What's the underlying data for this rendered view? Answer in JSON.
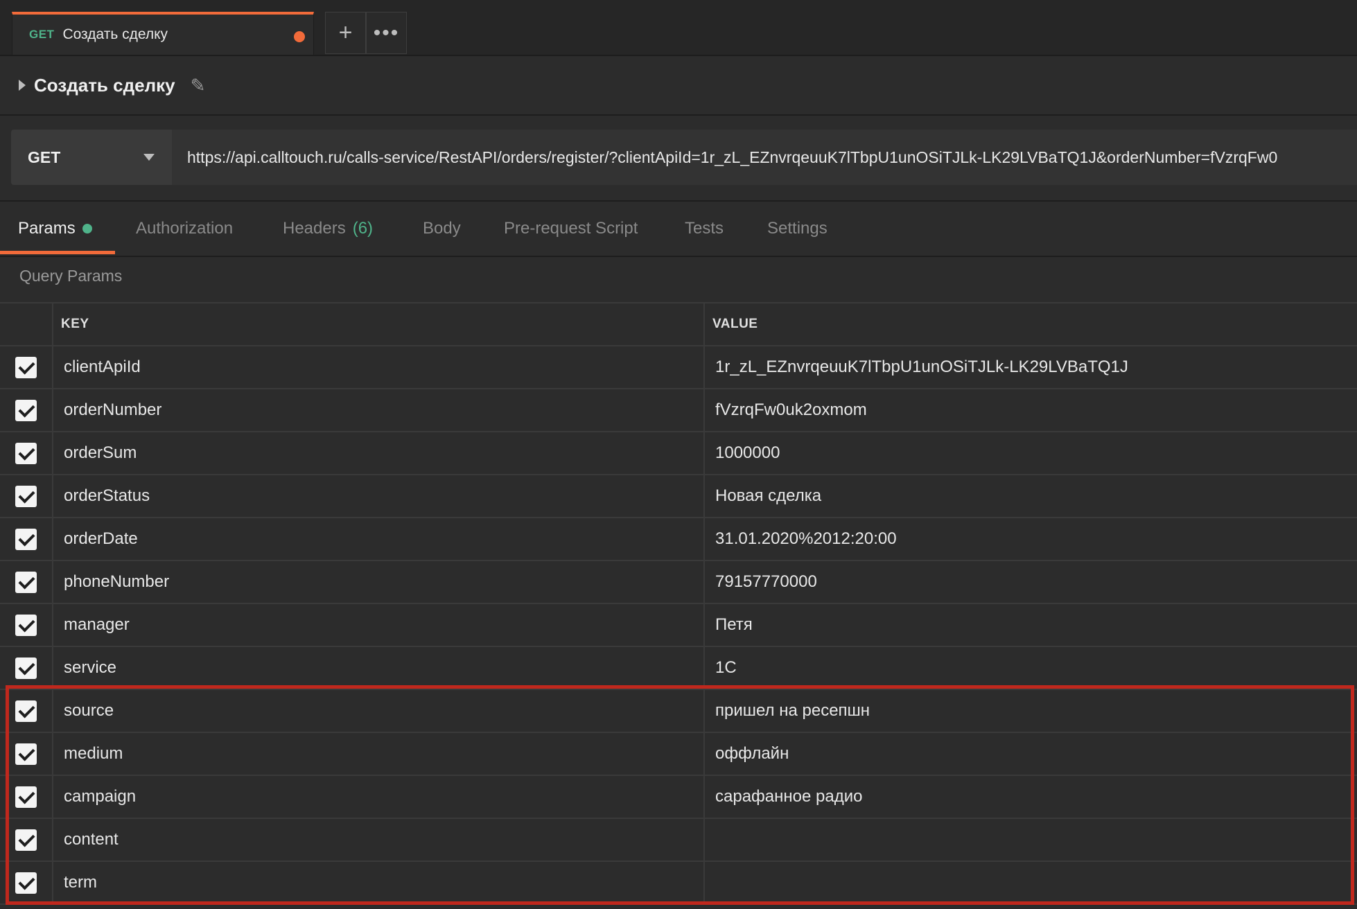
{
  "tab": {
    "method": "GET",
    "name": "Создать сделку",
    "unsaved": true
  },
  "tab_actions": {
    "new_tab": "+",
    "more": "•••"
  },
  "request": {
    "title": "Создать сделку"
  },
  "url_bar": {
    "method": "GET",
    "url": "https://api.calltouch.ru/calls-service/RestAPI/orders/register/?clientApiId=1r_zL_EZnvrqeuuK7lTbpU1unOSiTJLk-LK29LVBaTQ1J&orderNumber=fVzrqFw0"
  },
  "request_tabs": {
    "params": "Params",
    "authorization": "Authorization",
    "headers": "Headers",
    "headers_count": "(6)",
    "body": "Body",
    "pre_request": "Pre-request Script",
    "tests": "Tests",
    "settings": "Settings"
  },
  "query_params": {
    "title": "Query Params",
    "col_key": "KEY",
    "col_value": "VALUE",
    "rows": [
      {
        "key": "clientApiId",
        "value": "1r_zL_EZnvrqeuuK7lTbpU1unOSiTJLk-LK29LVBaTQ1J",
        "checked": true
      },
      {
        "key": "orderNumber",
        "value": "fVzrqFw0uk2oxmom",
        "checked": true
      },
      {
        "key": "orderSum",
        "value": "1000000",
        "checked": true
      },
      {
        "key": "orderStatus",
        "value": "Новая сделка",
        "checked": true
      },
      {
        "key": "orderDate",
        "value": "31.01.2020%2012:20:00",
        "checked": true
      },
      {
        "key": "phoneNumber",
        "value": "79157770000",
        "checked": true
      },
      {
        "key": "manager",
        "value": "Петя",
        "checked": true
      },
      {
        "key": "service",
        "value": "1C",
        "checked": true
      },
      {
        "key": "source",
        "value": "пришел на ресепшн",
        "checked": true
      },
      {
        "key": "medium",
        "value": "оффлайн",
        "checked": true
      },
      {
        "key": "campaign",
        "value": "сарафанное радио",
        "checked": true
      },
      {
        "key": "content",
        "value": "",
        "checked": true
      },
      {
        "key": "term",
        "value": "",
        "checked": true
      }
    ]
  },
  "colors": {
    "accent": "#f26b3a",
    "method_green": "#4fb38a",
    "highlight_red": "#c0281d"
  }
}
